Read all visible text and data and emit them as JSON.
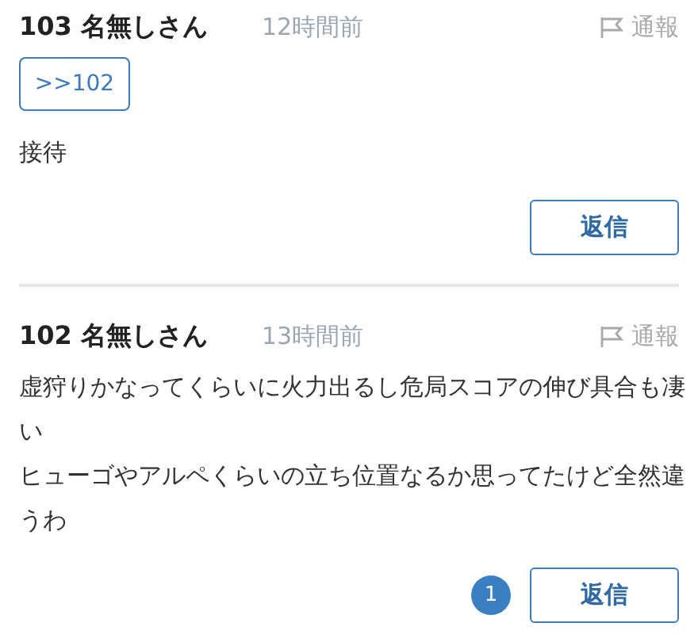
{
  "posts": [
    {
      "number": "103",
      "name": "名無しさん",
      "time": "12時間前",
      "report": "通報",
      "quotes": [
        ">>102"
      ],
      "lines": [
        "接待"
      ],
      "reply": "返信"
    },
    {
      "number": "102",
      "name": "名無しさん",
      "time": "13時間前",
      "report": "通報",
      "lines": [
        "虚狩りかなってくらいに火力出るし危局スコアの伸び具合も凄い",
        "ヒューゴやアルペくらいの立ち位置なるか思ってたけど全然違うわ"
      ],
      "reply_count": "1",
      "reply": "返信"
    }
  ]
}
